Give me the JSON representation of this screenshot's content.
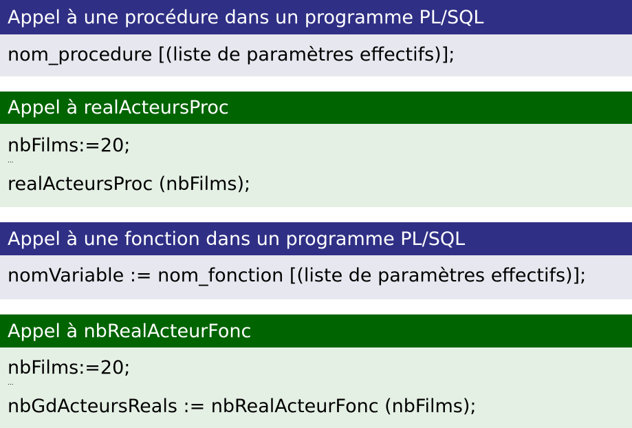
{
  "blocks": [
    {
      "title": "Appel à une procédure dans un programme PL/SQL",
      "lines": [
        "nom_procedure [(liste de paramètres effectifs)];"
      ]
    },
    {
      "title": "Appel à realActeursProc",
      "lines": [
        "nbFilms:=20;",
        "...",
        "realActeursProc (nbFilms);"
      ]
    },
    {
      "title": "Appel à une fonction dans un programme PL/SQL",
      "lines": [
        "nomVariable := nom_fonction [(liste de paramètres effectifs)];"
      ]
    },
    {
      "title": "Appel à nbRealActeurFonc",
      "lines": [
        "nbFilms:=20;",
        "...",
        "nbGdActeursReals := nbRealActeurFonc (nbFilms);"
      ]
    }
  ],
  "colors": {
    "alert_header": "#2f2f85",
    "alert_body": "#e7e7ef",
    "example_header": "#006400",
    "example_body": "#e5f0e5"
  }
}
